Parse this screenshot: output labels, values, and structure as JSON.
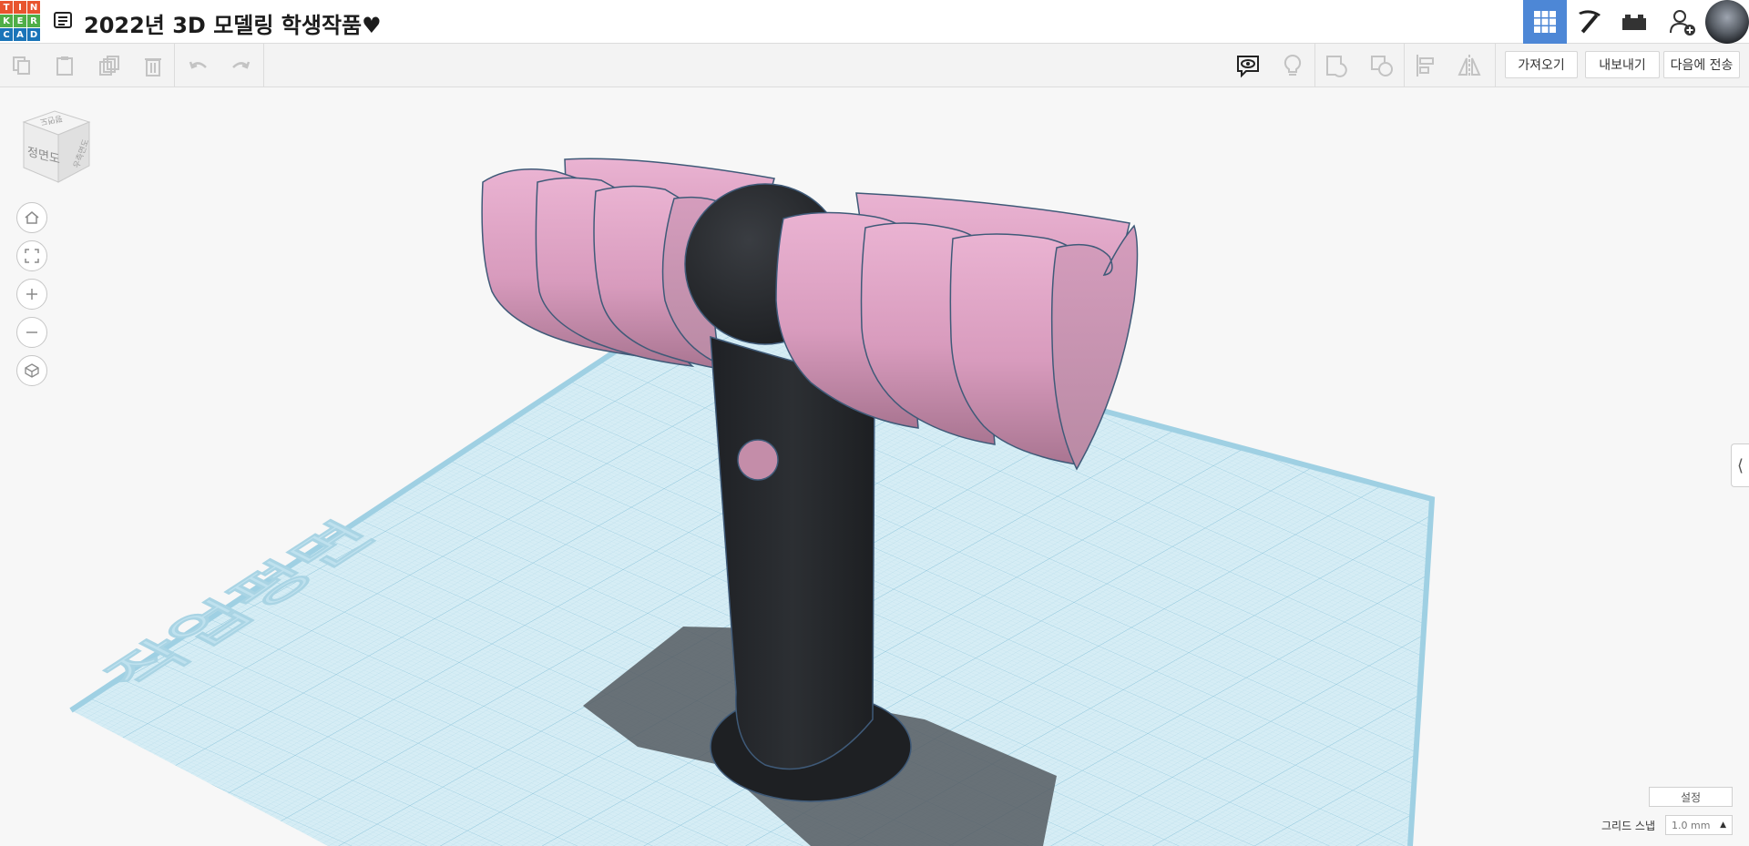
{
  "app": {
    "logo_letters": [
      "T",
      "I",
      "N",
      "K",
      "E",
      "R",
      "C",
      "A",
      "D"
    ],
    "logo_colors": [
      "#e8542e",
      "#e8542e",
      "#e8542e",
      "#4fae47",
      "#4fae47",
      "#4fae47",
      "#1a74b8",
      "#1a74b8",
      "#1a74b8"
    ],
    "title": "2022년 3D 모델링 학생작품♥"
  },
  "header_buttons": [
    {
      "name": "3d-design-view",
      "icon": "grid-icon",
      "active": true
    },
    {
      "name": "blocks-view",
      "icon": "pickaxe-icon",
      "active": false
    },
    {
      "name": "bricks-view",
      "icon": "brick-icon",
      "active": false
    },
    {
      "name": "add-user",
      "icon": "user-plus-icon",
      "active": false
    }
  ],
  "toolbar": {
    "import_label": "가져오기",
    "export_label": "내보내기",
    "send_to_label": "다음에 전송"
  },
  "viewcube": {
    "front_label": "정면도",
    "top_label": "평면도",
    "side_label": "우측면도"
  },
  "workplane": {
    "label": "작업평면"
  },
  "bottom": {
    "settings_label": "설정",
    "grid_snap_label": "그리드 스냅",
    "grid_snap_value": "1.0 mm"
  },
  "colors": {
    "accent": "#4d87d6",
    "shape_pink": "#e3a6c8",
    "shape_dark": "#25272b",
    "grid": "#bfe3f0"
  }
}
